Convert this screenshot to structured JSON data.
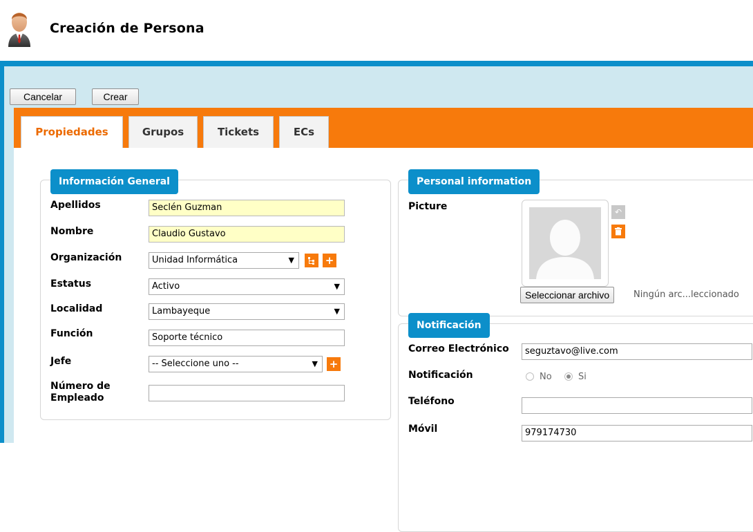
{
  "header": {
    "title": "Creación de Persona"
  },
  "toolbar": {
    "cancel_label": "Cancelar",
    "create_label": "Crear"
  },
  "tabs": [
    {
      "label": "Propiedades",
      "active": true
    },
    {
      "label": "Grupos",
      "active": false
    },
    {
      "label": "Tickets",
      "active": false
    },
    {
      "label": "ECs",
      "active": false
    }
  ],
  "general": {
    "legend": "Información General",
    "apellidos": {
      "label": "Apellidos",
      "value": "Seclén Guzman"
    },
    "nombre": {
      "label": "Nombre",
      "value": "Claudio Gustavo"
    },
    "organizacion": {
      "label": "Organización",
      "value": "Unidad Informática"
    },
    "estatus": {
      "label": "Estatus",
      "value": "Activo"
    },
    "localidad": {
      "label": "Localidad",
      "value": "Lambayeque"
    },
    "funcion": {
      "label": "Función",
      "value": "Soporte técnico"
    },
    "jefe": {
      "label": "Jefe",
      "value": "-- Seleccione uno --"
    },
    "numero": {
      "label_line1": "Número de",
      "label_line2": "Empleado",
      "value": ""
    }
  },
  "personal": {
    "legend": "Personal information",
    "picture_label": "Picture",
    "file_button": "Seleccionar archivo",
    "file_status": "Ningún arc...leccionado"
  },
  "notificacion": {
    "legend": "Notificación",
    "email": {
      "label": "Correo Electrónico",
      "value": "seguztavo@live.com"
    },
    "notif": {
      "label": "Notificación",
      "no_label": "No",
      "si_label": "Si",
      "selected": "Si"
    },
    "telefono": {
      "label": "Teléfono",
      "value": ""
    },
    "movil": {
      "label": "Móvil",
      "value": "979174730"
    }
  },
  "icons": {
    "select_arrow": "▼",
    "plus": "+",
    "undo": "↶",
    "trash": "trash-icon",
    "tree": "tree-icon"
  },
  "colors": {
    "accent_orange": "#f77a0c",
    "accent_blue": "#0c8fca",
    "required_field": "#ffffc6"
  }
}
